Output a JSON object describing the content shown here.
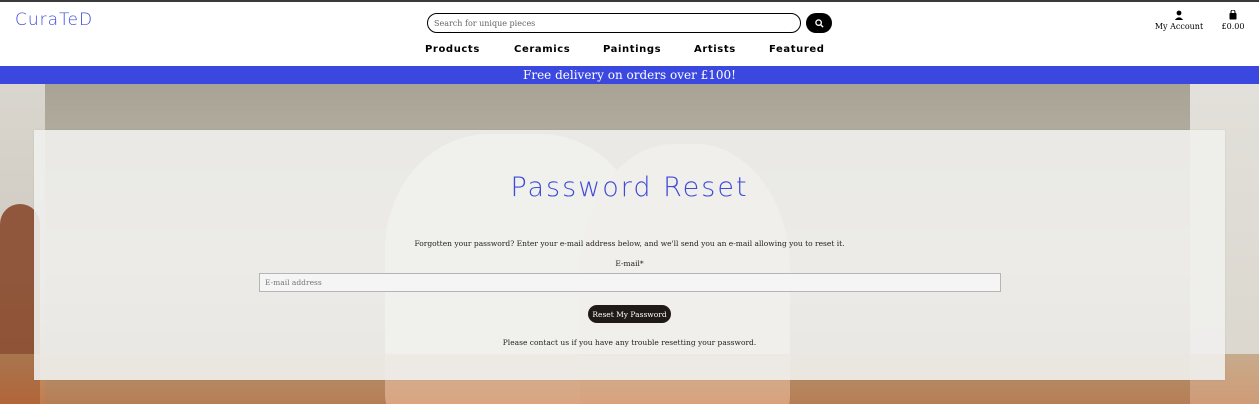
{
  "brand": {
    "logo": "CuraTeD",
    "accent": "#3d4bd8"
  },
  "header": {
    "search": {
      "placeholder": "Search for unique pieces"
    },
    "account_label": "My Account",
    "cart_total": "£0.00"
  },
  "nav": {
    "items": [
      "Products",
      "Ceramics",
      "Paintings",
      "Artists",
      "Featured"
    ]
  },
  "banner": {
    "text": "Free delivery on orders over £100!",
    "color": "#3a48e0"
  },
  "form": {
    "title": "Password Reset",
    "intro": "Forgotten your password? Enter your e-mail address below, and we'll send you an e-mail allowing you to reset it.",
    "email_label": "E-mail*",
    "email_placeholder": "E-mail address",
    "button_label": "Reset My Password",
    "contact_text": "Please contact us if you have any trouble resetting your password."
  },
  "icons": {
    "search": "search-icon",
    "account": "user-icon",
    "cart": "shopping-bag-icon"
  }
}
